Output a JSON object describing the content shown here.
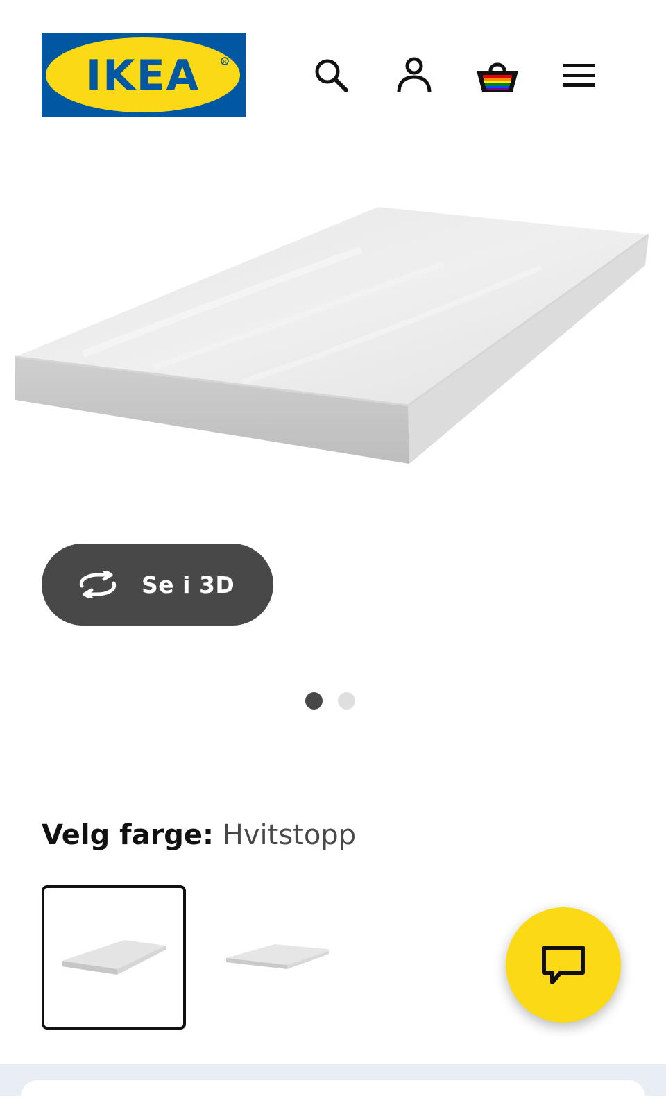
{
  "header": {
    "logo_text": "IKEA",
    "icons": {
      "search": "search-icon",
      "account": "user-icon",
      "cart": "shopping-basket-icon",
      "menu": "hamburger-menu-icon"
    }
  },
  "gallery": {
    "view_3d_label": "Se i 3D",
    "view_3d_icon": "rotate-3d-icon",
    "dots": [
      {
        "active": true
      },
      {
        "active": false
      }
    ]
  },
  "color_picker": {
    "label": "Velg farge:",
    "selected_value": "Hvitstopp",
    "options": [
      {
        "selected": true
      },
      {
        "selected": false
      }
    ]
  },
  "chat": {
    "icon": "chat-bubble-icon"
  },
  "colors": {
    "ikea_blue": "#0058a3",
    "ikea_yellow": "#fbd914",
    "button_dark": "#484848",
    "text_dark": "#111111"
  }
}
